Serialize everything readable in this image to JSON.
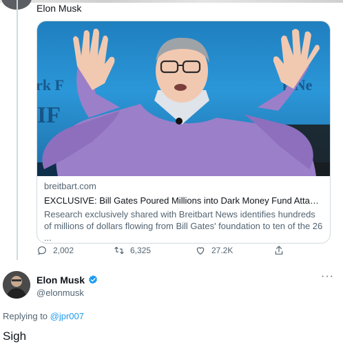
{
  "previous_tweet": {
    "author_name": "Elon Musk"
  },
  "link_card": {
    "domain": "breitbart.com",
    "title": "EXCLUSIVE: Bill Gates Poured Millions into Dark Money Fund Attackin...",
    "description": "Research exclusively shared with Breitbart News identifies hundreds of millions of dollars flowing from Bill Gates' foundation to ten of the 26 ...",
    "image_background_text": [
      "rk F",
      "IF",
      "k Ne"
    ]
  },
  "actions": {
    "reply_count": "2,002",
    "retweet_count": "6,325",
    "like_count": "27.2K"
  },
  "reply": {
    "author_name": "Elon Musk",
    "author_handle": "@elonmusk",
    "replying_to_label": "Replying to ",
    "replying_to_handle": "@jpr007",
    "text": "Sigh"
  },
  "colors": {
    "accent": "#1d9bf0",
    "secondary_text": "#536471",
    "card_sweater": "#9b7fc9",
    "card_background": "#2b97d8"
  }
}
